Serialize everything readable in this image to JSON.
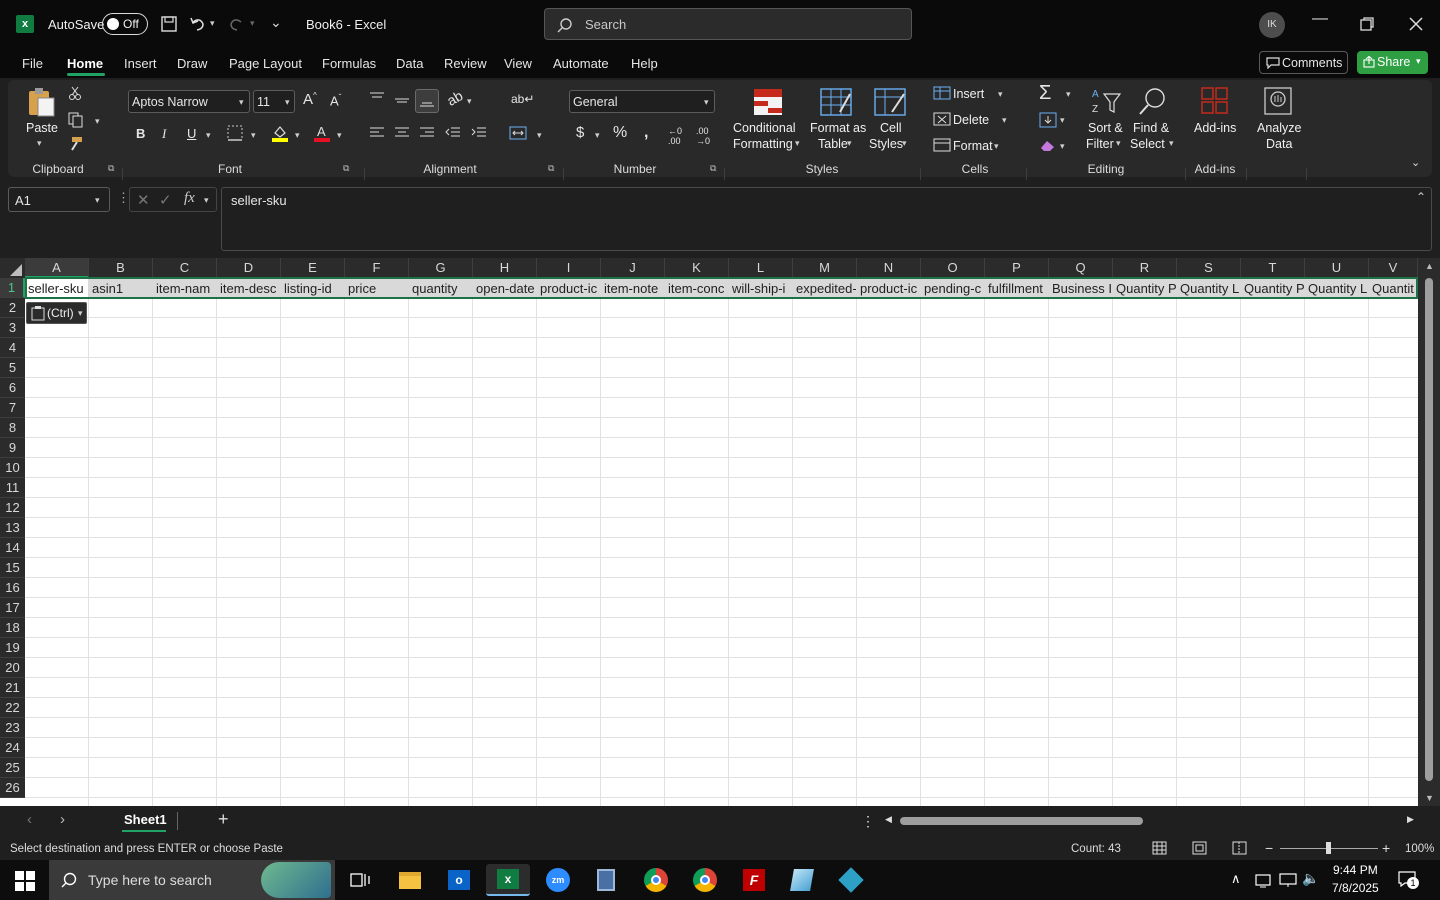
{
  "title_bar": {
    "autosave_label": "AutoSave",
    "autosave_state": "Off",
    "doc_title": "Book6  -  Excel",
    "search_placeholder": "Search",
    "avatar_initials": "IK"
  },
  "menu": {
    "tabs": [
      "File",
      "Home",
      "Insert",
      "Draw",
      "Page Layout",
      "Formulas",
      "Data",
      "Review",
      "View",
      "Automate",
      "Help"
    ],
    "active": "Home",
    "comments_label": "Comments",
    "share_label": "Share"
  },
  "ribbon": {
    "clipboard": {
      "paste": "Paste",
      "group": "Clipboard"
    },
    "font": {
      "family": "Aptos Narrow",
      "size": "11",
      "group": "Font"
    },
    "alignment": {
      "group": "Alignment"
    },
    "number": {
      "format": "General",
      "group": "Number"
    },
    "styles": {
      "cond1": "Conditional",
      "cond2": "Formatting",
      "fmt1": "Format as",
      "fmt2": "Table",
      "cell1": "Cell",
      "cell2": "Styles",
      "group": "Styles"
    },
    "cells": {
      "insert": "Insert",
      "delete": "Delete",
      "format": "Format",
      "group": "Cells"
    },
    "editing": {
      "sort1": "Sort &",
      "sort2": "Filter",
      "find1": "Find &",
      "find2": "Select",
      "group": "Editing"
    },
    "addins": {
      "addins": "Add-ins",
      "group": "Add-ins",
      "analyze1": "Analyze",
      "analyze2": "Data"
    }
  },
  "formula_bar": {
    "name_box": "A1",
    "content": "seller-sku"
  },
  "grid": {
    "columns": [
      "A",
      "B",
      "C",
      "D",
      "E",
      "F",
      "G",
      "H",
      "I",
      "J",
      "K",
      "L",
      "M",
      "N",
      "O",
      "P",
      "Q",
      "R",
      "S",
      "T",
      "U",
      "V"
    ],
    "rows": [
      "1",
      "2",
      "3",
      "4",
      "5",
      "6",
      "7",
      "8",
      "9",
      "10",
      "11",
      "12",
      "13",
      "14",
      "15",
      "16",
      "17",
      "18",
      "19",
      "20",
      "21",
      "22",
      "23",
      "24",
      "25",
      "26"
    ],
    "row1": [
      "seller-sku",
      "asin1",
      "item-nam",
      "item-desc",
      "listing-id",
      "price",
      "quantity",
      "open-date",
      "product-ic",
      "item-note",
      "item-conc",
      "will-ship-i",
      "expedited-",
      "product-ic",
      "pending-c",
      "fulfillment",
      "Business I",
      "Quantity P",
      "Quantity L",
      "Quantity P",
      "Quantity L",
      "Quantit"
    ],
    "paste_tag": "(Ctrl)"
  },
  "sheet_tabs": {
    "active": "Sheet1",
    "add_label": "+"
  },
  "status": {
    "message": "Select destination and press ENTER or choose Paste",
    "count": "Count: 43",
    "zoom": "100%"
  },
  "taskbar": {
    "search_placeholder": "Type here to search",
    "time": "9:44 PM",
    "date": "7/8/2025",
    "notif_count": "1"
  },
  "colors": {
    "excel_green": "#107c41",
    "share_green": "#2ea043",
    "selection": "#1e7145"
  }
}
